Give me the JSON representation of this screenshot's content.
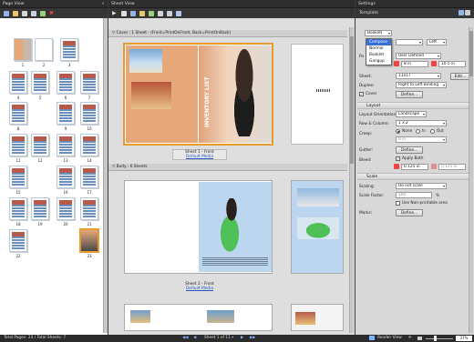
{
  "page_view": {
    "title": "Page View",
    "close": "×",
    "thumbs": [
      {
        "num": "1"
      },
      {
        "num": "2"
      },
      {
        "num": "3"
      },
      {
        "num": "4"
      },
      {
        "num": "5"
      },
      {
        "num": "6"
      },
      {
        "num": "7"
      },
      {
        "num": "8"
      },
      {
        "num": "9"
      },
      {
        "num": "10"
      },
      {
        "num": "11"
      },
      {
        "num": "12"
      },
      {
        "num": "13"
      },
      {
        "num": "14"
      },
      {
        "num": "15"
      },
      {
        "num": "16"
      },
      {
        "num": "17"
      },
      {
        "num": "18"
      },
      {
        "num": "19"
      },
      {
        "num": "20"
      },
      {
        "num": "21"
      },
      {
        "num": "22"
      },
      {
        "num": "23"
      }
    ]
  },
  "sheet_view": {
    "title": "Sheet View",
    "cover_header": "Cover : 1 Sheet - (Front=PrintOnFront, Back=PrintOnBack)",
    "body_header": "Body : 6 Sheets",
    "cover_caption": "Sheet 1 - Front",
    "cover_link": "Default Media",
    "inventory_text": "INVENTORY LIST",
    "body_caption": "Sheet 2 - Front",
    "body_link": "Default Media",
    "pagination": "Sheet 1 of 11"
  },
  "settings": {
    "title": "Settings",
    "template_label": "Template",
    "template_value": "Booklet",
    "dropdown_options": [
      "Compose",
      "Normal",
      "Booklet",
      "Gangup"
    ],
    "dropdown_selected": "Compose",
    "binding_value": "Left",
    "paper_label": "Pa",
    "paper_value": "User Defined",
    "width_value": "8 in",
    "height_value": "10.5 in",
    "sheet_label": "Sheet:",
    "sheet_value": "11x17",
    "edit_btn": "Edit...",
    "duplex_label": "Duplex:",
    "duplex_value": "Right to Left Binding",
    "cover_label": "Cover",
    "define_btn": "Define...",
    "layout_group": "Layout",
    "orientation_label": "Layout Orientation:",
    "orientation_value": "Landscape",
    "rowcol_label": "Row & Column:",
    "rowcol_value": "1 x 2",
    "creep_label": "Creep:",
    "creep_none": "None",
    "creep_in": "In",
    "creep_out": "Out",
    "creep_value": "0 in",
    "gutter_label": "Gutter:",
    "gutter_btn": "Define...",
    "bleed_label": "Bleed:",
    "apply_both": "Apply Both",
    "bleed_a": "0.125 in",
    "bleed_b": "0.125 in",
    "scale_group": "Scale",
    "scaling_label": "Scaling:",
    "scaling_value": "Do not scale",
    "scale_factor_label": "Scale Factor:",
    "scale_factor_value": "100",
    "percent": "%",
    "non_printable": "Use Non-printable area",
    "marks_label": "Marks:",
    "marks_btn": "Define..."
  },
  "status": {
    "left": "Total Pages: 23 / Total Sheets: 7",
    "reader_view": "Reader View",
    "zoom": "37%"
  },
  "colors": {
    "accent": "#3a6fd6",
    "selection": "#e89a2c",
    "toolbar_dark": "#2e2e2e"
  }
}
